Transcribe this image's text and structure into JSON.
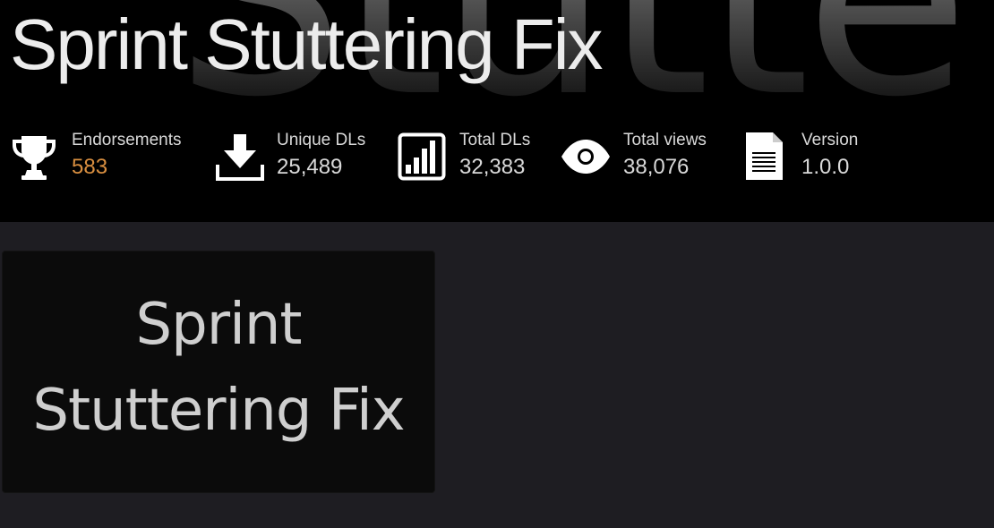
{
  "header": {
    "background_word": "Stutte",
    "title": "Sprint Stuttering Fix"
  },
  "stats": [
    {
      "icon": "trophy-icon",
      "label": "Endorsements",
      "value": "583",
      "value_color": "#d98f40"
    },
    {
      "icon": "download-icon",
      "label": "Unique DLs",
      "value": "25,489"
    },
    {
      "icon": "bar-chart-icon",
      "label": "Total DLs",
      "value": "32,383"
    },
    {
      "icon": "eye-icon",
      "label": "Total views",
      "value": "38,076"
    },
    {
      "icon": "document-icon",
      "label": "Version",
      "value": "1.0.0"
    }
  ],
  "thumbnail": {
    "line1": "Sprint",
    "line2": "Stuttering Fix"
  },
  "colors": {
    "header_bg": "#000000",
    "page_bg": "#1e1d22",
    "accent": "#d98f40",
    "text": "#d9d9d9"
  }
}
